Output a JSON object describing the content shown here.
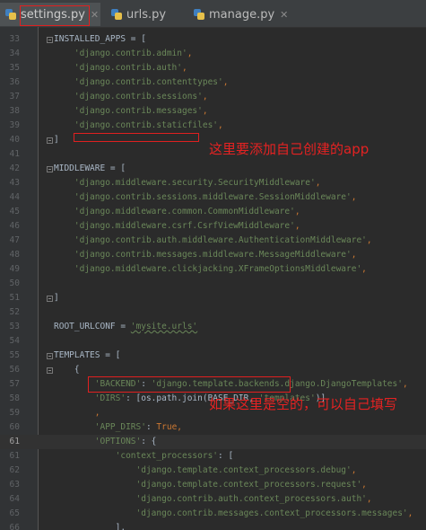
{
  "tabs": [
    {
      "label": "settings.py",
      "icon": "python-file-icon",
      "active": true
    },
    {
      "label": "urls.py",
      "icon": "python-file-icon",
      "active": false
    },
    {
      "label": "manage.py",
      "icon": "python-file-icon",
      "active": false
    }
  ],
  "close_glyph": "✕",
  "annotations": {
    "installed_apps_note": "这里要添加自己创建的app",
    "dirs_note": "如果这里是空的，可以自己填写"
  },
  "editor": {
    "current_line": "61",
    "lines": [
      {
        "n": "33",
        "segs": [
          {
            "t": "INSTALLED_APPS = [",
            "c": "op"
          }
        ]
      },
      {
        "n": "34",
        "segs": [
          {
            "t": "    'django.contrib.admin'",
            "c": "str"
          },
          {
            "t": ",",
            "c": "kw"
          }
        ]
      },
      {
        "n": "35",
        "segs": [
          {
            "t": "    'django.contrib.auth'",
            "c": "str"
          },
          {
            "t": ",",
            "c": "kw"
          }
        ]
      },
      {
        "n": "36",
        "segs": [
          {
            "t": "    'django.contrib.contenttypes'",
            "c": "str"
          },
          {
            "t": ",",
            "c": "kw"
          }
        ]
      },
      {
        "n": "37",
        "segs": [
          {
            "t": "    'django.contrib.sessions'",
            "c": "str"
          },
          {
            "t": ",",
            "c": "kw"
          }
        ]
      },
      {
        "n": "38",
        "segs": [
          {
            "t": "    'django.contrib.messages'",
            "c": "str"
          },
          {
            "t": ",",
            "c": "kw"
          }
        ]
      },
      {
        "n": "39",
        "segs": [
          {
            "t": "    'django.contrib.staticfiles'",
            "c": "str"
          },
          {
            "t": ",",
            "c": "kw"
          }
        ]
      },
      {
        "n": "40",
        "segs": [
          {
            "t": "]",
            "c": "op"
          }
        ]
      },
      {
        "n": "41",
        "segs": []
      },
      {
        "n": "42",
        "segs": [
          {
            "t": "MIDDLEWARE = [",
            "c": "op"
          }
        ]
      },
      {
        "n": "43",
        "segs": [
          {
            "t": "    'django.middleware.security.SecurityMiddleware'",
            "c": "str"
          },
          {
            "t": ",",
            "c": "kw"
          }
        ]
      },
      {
        "n": "44",
        "segs": [
          {
            "t": "    'django.contrib.sessions.middleware.SessionMiddleware'",
            "c": "str"
          },
          {
            "t": ",",
            "c": "kw"
          }
        ]
      },
      {
        "n": "45",
        "segs": [
          {
            "t": "    'django.middleware.common.CommonMiddleware'",
            "c": "str"
          },
          {
            "t": ",",
            "c": "kw"
          }
        ]
      },
      {
        "n": "46",
        "segs": [
          {
            "t": "    'django.middleware.csrf.CsrfViewMiddleware'",
            "c": "str"
          },
          {
            "t": ",",
            "c": "kw"
          }
        ]
      },
      {
        "n": "47",
        "segs": [
          {
            "t": "    'django.contrib.auth.middleware.AuthenticationMiddleware'",
            "c": "str"
          },
          {
            "t": ",",
            "c": "kw"
          }
        ]
      },
      {
        "n": "48",
        "segs": [
          {
            "t": "    'django.contrib.messages.middleware.MessageMiddleware'",
            "c": "str"
          },
          {
            "t": ",",
            "c": "kw"
          }
        ]
      },
      {
        "n": "49",
        "segs": [
          {
            "t": "    'django.middleware.clickjacking.XFrameOptionsMiddleware'",
            "c": "str"
          },
          {
            "t": ",",
            "c": "kw"
          }
        ]
      },
      {
        "n": "50",
        "segs": []
      },
      {
        "n": "51",
        "segs": [
          {
            "t": "]",
            "c": "op"
          }
        ]
      },
      {
        "n": "52",
        "segs": []
      },
      {
        "n": "53",
        "segs": [
          {
            "t": "ROOT_URLCONF = ",
            "c": "op"
          },
          {
            "t": "'mysite.urls'",
            "c": "str url-underline"
          }
        ]
      },
      {
        "n": "54",
        "segs": []
      },
      {
        "n": "55",
        "segs": [
          {
            "t": "TEMPLATES = [",
            "c": "op"
          }
        ]
      },
      {
        "n": "56",
        "segs": [
          {
            "t": "    {",
            "c": "op"
          }
        ]
      },
      {
        "n": "57",
        "segs": [
          {
            "t": "        'BACKEND'",
            "c": "str"
          },
          {
            "t": ": ",
            "c": "op"
          },
          {
            "t": "'django.template.backends.django.DjangoTemplates'",
            "c": "str"
          },
          {
            "t": ",",
            "c": "kw"
          }
        ]
      },
      {
        "n": "58",
        "segs": [
          {
            "t": "        'DIRS'",
            "c": "str"
          },
          {
            "t": ": [os.path.join(BASE_DIR, ",
            "c": "op"
          },
          {
            "t": "'templates'",
            "c": "str"
          },
          {
            "t": ")]",
            "c": "op"
          }
        ]
      },
      {
        "n": "59",
        "segs": [
          {
            "t": "        ,",
            "c": "kw"
          }
        ]
      },
      {
        "n": "60",
        "segs": [
          {
            "t": "        'APP_DIRS'",
            "c": "str"
          },
          {
            "t": ": ",
            "c": "op"
          },
          {
            "t": "True",
            "c": "kw"
          },
          {
            "t": ",",
            "c": "kw"
          }
        ]
      },
      {
        "n": "61",
        "segs": [
          {
            "t": "        'OPTIONS'",
            "c": "str"
          },
          {
            "t": ": {",
            "c": "op"
          }
        ]
      },
      {
        "n": "61",
        "segs": [
          {
            "t": "            'context_processors'",
            "c": "str"
          },
          {
            "t": ": [",
            "c": "op"
          }
        ]
      },
      {
        "n": "62",
        "segs": [
          {
            "t": "                'django.template.context_processors.debug'",
            "c": "str"
          },
          {
            "t": ",",
            "c": "kw"
          }
        ]
      },
      {
        "n": "63",
        "segs": [
          {
            "t": "                'django.template.context_processors.request'",
            "c": "str"
          },
          {
            "t": ",",
            "c": "kw"
          }
        ]
      },
      {
        "n": "64",
        "segs": [
          {
            "t": "                'django.contrib.auth.context_processors.auth'",
            "c": "str"
          },
          {
            "t": ",",
            "c": "kw"
          }
        ]
      },
      {
        "n": "65",
        "segs": [
          {
            "t": "                'django.contrib.messages.context_processors.messages'",
            "c": "str"
          },
          {
            "t": ",",
            "c": "kw"
          }
        ]
      },
      {
        "n": "66",
        "segs": [
          {
            "t": "            ],",
            "c": "op"
          }
        ]
      },
      {
        "n": "67",
        "segs": [
          {
            "t": "        },",
            "c": "op"
          }
        ]
      }
    ]
  }
}
